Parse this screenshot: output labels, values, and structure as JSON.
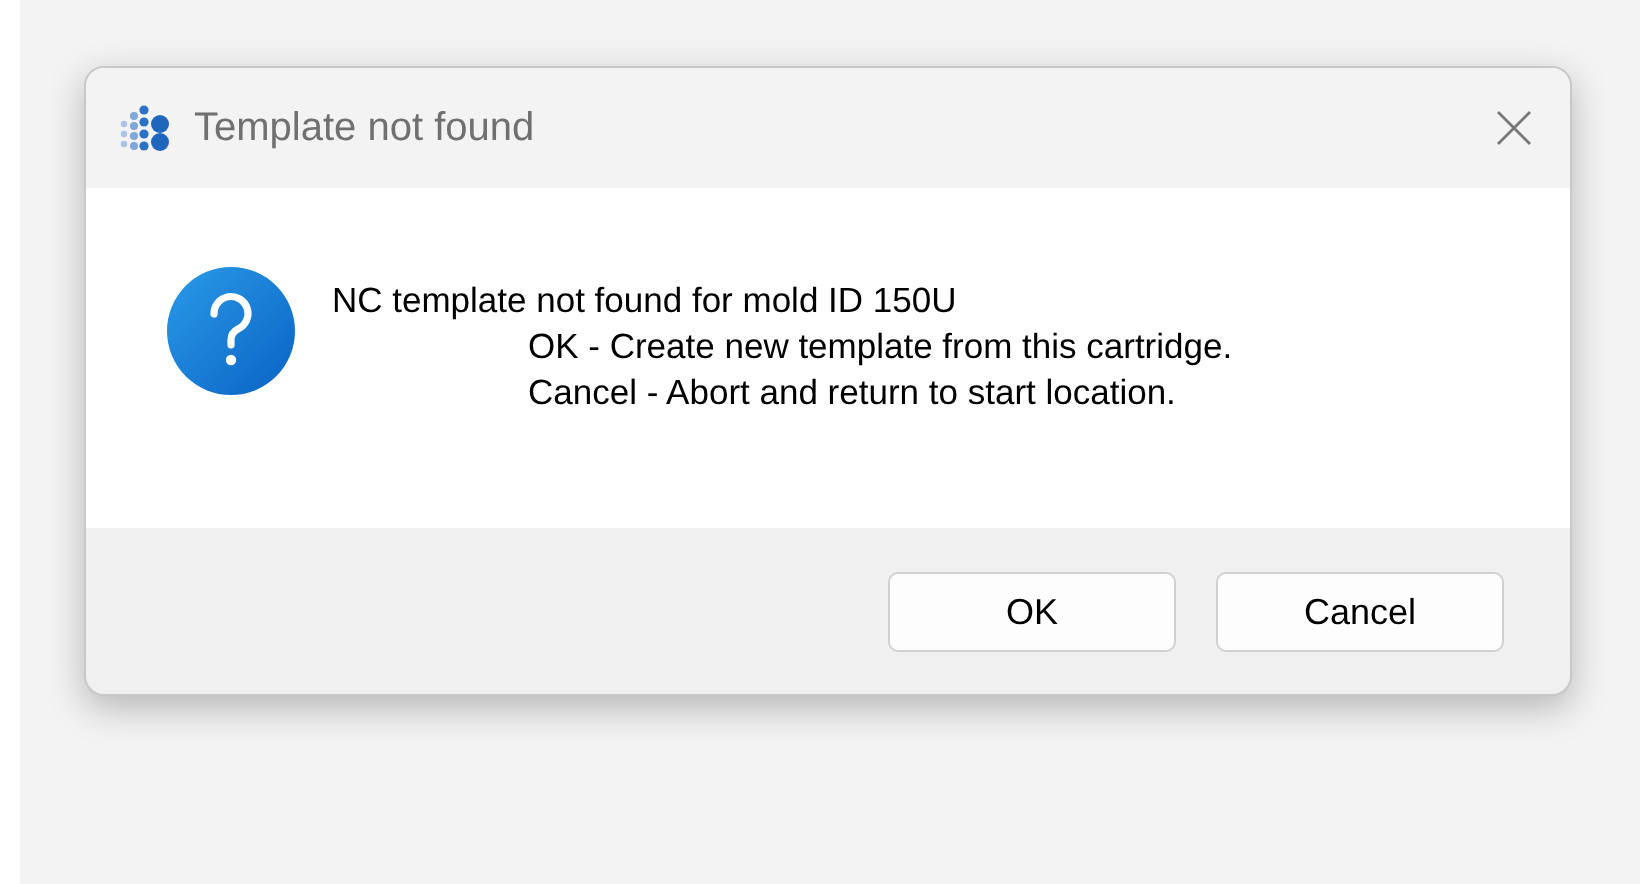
{
  "window": {
    "title": "Template not found"
  },
  "message": {
    "lines": [
      {
        "text": "NC template not found for mold ID 150U",
        "indented": false
      },
      {
        "text": "OK - Create new template from this cartridge.",
        "indented": true
      },
      {
        "text": "Cancel - Abort and return to start location.",
        "indented": true
      }
    ]
  },
  "buttons": [
    {
      "label": "OK"
    },
    {
      "label": "Cancel"
    }
  ]
}
